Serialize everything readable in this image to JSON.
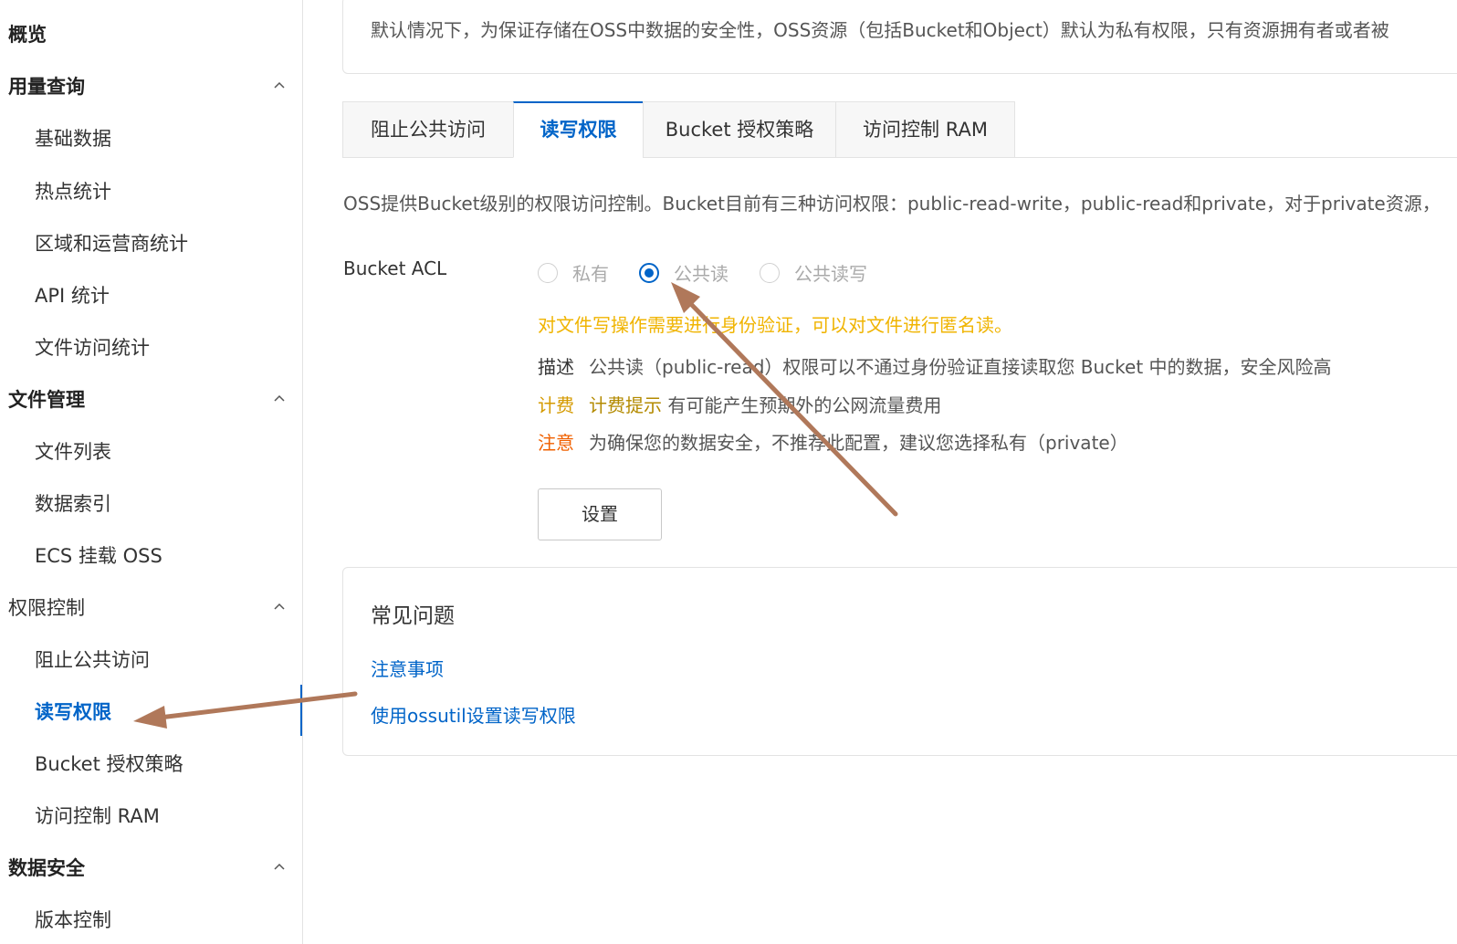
{
  "sidebar": {
    "overview": "概览",
    "usage": {
      "title": "用量查询",
      "items": [
        "基础数据",
        "热点统计",
        "区域和运营商统计",
        "API 统计",
        "文件访问统计"
      ]
    },
    "files": {
      "title": "文件管理",
      "items": [
        "文件列表",
        "数据索引",
        "ECS 挂载 OSS"
      ]
    },
    "permissions": {
      "title": "权限控制",
      "items": [
        "阻止公共访问",
        "读写权限",
        "Bucket 授权策略",
        "访问控制 RAM"
      ]
    },
    "security": {
      "title": "数据安全",
      "items": [
        "版本控制"
      ]
    }
  },
  "notice": "默认情况下，为保证存储在OSS中数据的安全性，OSS资源（包括Bucket和Object）默认为私有权限，只有资源拥有者或者被",
  "tabs": [
    "阻止公共访问",
    "读写权限",
    "Bucket 授权策略",
    "访问控制 RAM"
  ],
  "description": "OSS提供Bucket级别的权限访问控制。Bucket目前有三种访问权限：public-read-write，public-read和private，对于private资源，",
  "acl": {
    "label": "Bucket ACL",
    "options": [
      "私有",
      "公共读",
      "公共读写"
    ],
    "selected_option": "公共读",
    "warning": "对文件写操作需要进行身份验证，可以对文件进行匿名读。",
    "desc_key": "描述",
    "desc_value": "公共读（public-read）权限可以不通过身份验证直接读取您 Bucket 中的数据，安全风险高",
    "fee_key": "计费",
    "fee_tip": "计费提示",
    "fee_value": "有可能产生预期外的公网流量费用",
    "note_key": "注意",
    "note_value": "为确保您的数据安全，不推荐此配置，建议您选择私有（private）",
    "button": "设置"
  },
  "faq": {
    "title": "常见问题",
    "links": [
      "注意事项",
      "使用ossutil设置读写权限"
    ]
  },
  "colors": {
    "accent": "#0064c8",
    "warning": "#f0b400",
    "note": "#f06000",
    "annotation_arrow": "#b0785a"
  }
}
